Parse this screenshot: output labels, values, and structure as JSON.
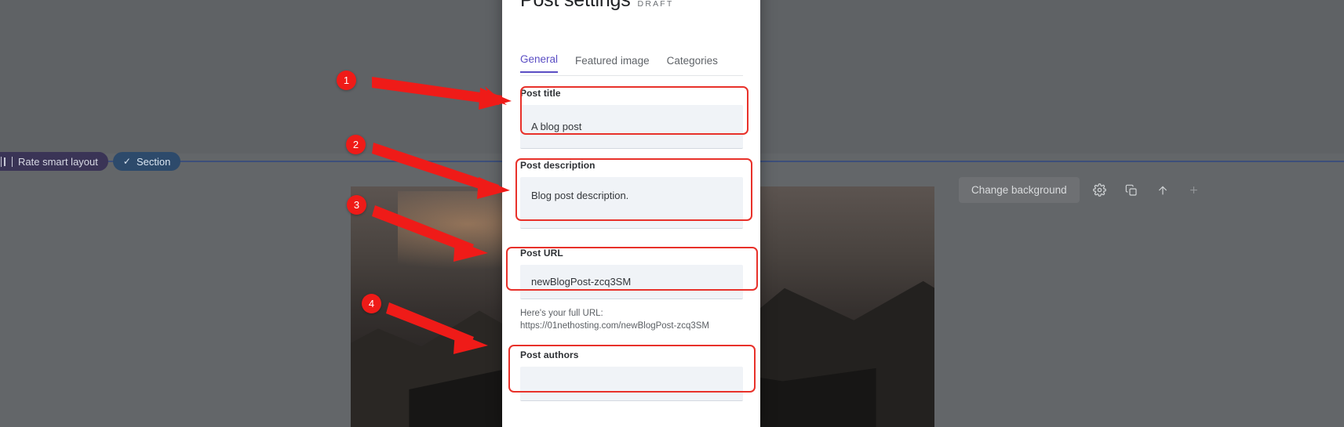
{
  "editor": {
    "pills": [
      {
        "label": "Rate smart layout",
        "icon": "rate-layout-icon"
      },
      {
        "label": "Section",
        "icon": "check-icon"
      }
    ],
    "toolbar": {
      "change_background_label": "Change background",
      "icons": [
        "gear-icon",
        "duplicate-icon",
        "move-up-icon",
        "add-icon"
      ]
    }
  },
  "modal": {
    "title": "Post settings",
    "status_badge": "DRAFT",
    "close_label": "✕",
    "tabs": [
      {
        "label": "General",
        "active": true
      },
      {
        "label": "Featured image",
        "active": false
      },
      {
        "label": "Categories",
        "active": false
      }
    ],
    "fields": {
      "post_title": {
        "label": "Post title",
        "value": "A blog post",
        "placeholder": "Post title"
      },
      "post_description": {
        "label": "Post description",
        "value": "Blog post description.",
        "placeholder": "Post description"
      },
      "post_url": {
        "label": "Post URL",
        "value": "newBlogPost-zcq3SM",
        "placeholder": "Post URL",
        "help_line_1": "Here's your full URL:",
        "help_line_2": "https://01nethosting.com/newBlogPost-zcq3SM"
      },
      "post_authors": {
        "label": "Post authors",
        "value": "",
        "placeholder": ""
      }
    }
  },
  "annotations": {
    "markers": [
      {
        "number": "1",
        "target": "post-title-input"
      },
      {
        "number": "2",
        "target": "post-description-input"
      },
      {
        "number": "3",
        "target": "post-url-input"
      },
      {
        "number": "4",
        "target": "post-authors-input"
      }
    ],
    "highlight_color": "#e8312a",
    "marker_color": "#ef1b18"
  }
}
